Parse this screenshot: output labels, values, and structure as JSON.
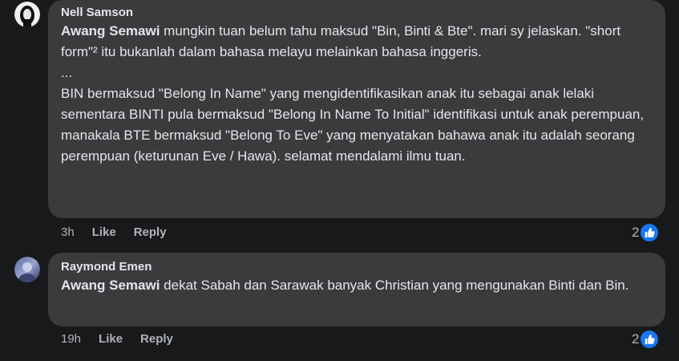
{
  "comments": [
    {
      "author": "Nell Samson",
      "mention": "Awang Semawi",
      "body": " mungkin tuan belum tahu maksud \"Bin, Binti & Bte\". mari sy jelaskan. \"short form\"² itu bukanlah dalam bahasa melayu melainkan bahasa inggeris.\n...\nBIN bermaksud \"Belong In Name\" yang mengidentifikasikan anak itu sebagai anak lelaki sementara BINTI pula bermaksud \"Belong In Name To Initial\" identifikasi untuk anak perempuan, manakala BTE bermaksud \"Belong To Eve\" yang menyatakan bahawa anak itu adalah seorang perempuan (keturunan Eve / Hawa). selamat mendalami ilmu tuan.",
      "time": "3h",
      "like_label": "Like",
      "reply_label": "Reply",
      "reaction_count": "2",
      "reaction_icon": "thumbs-up-icon",
      "accent_color": "#1877f2"
    },
    {
      "author": "Raymond Emen",
      "mention": "Awang Semawi",
      "body": " dekat Sabah dan Sarawak banyak Christian yang mengunakan Binti dan Bin.",
      "time": "19h",
      "like_label": "Like",
      "reply_label": "Reply",
      "reaction_count": "2",
      "reaction_icon": "thumbs-up-icon",
      "accent_color": "#1877f2"
    }
  ]
}
